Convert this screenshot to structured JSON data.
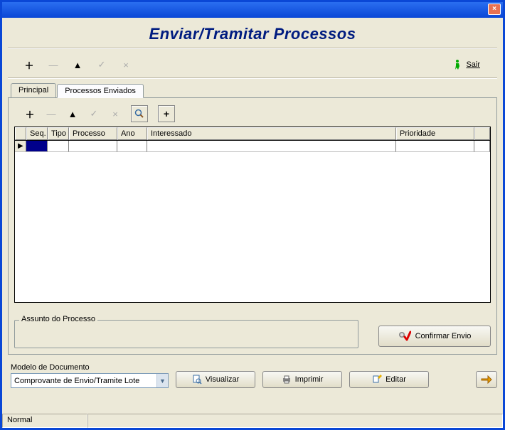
{
  "window": {
    "close_glyph": "×"
  },
  "header": {
    "title": "Enviar/Tramitar Processos"
  },
  "toolbar": {
    "exit_label": "Sair"
  },
  "tabs": {
    "principal": "Principal",
    "enviados": "Processos Enviados"
  },
  "grid": {
    "columns": {
      "seq": "Seq.",
      "tipo": "Tipo",
      "processo": "Processo",
      "ano": "Ano",
      "interessado": "Interessado",
      "prioridade": "Prioridade"
    },
    "row_marker": "▶"
  },
  "assunto": {
    "label": "Assunto do Processo",
    "value": ""
  },
  "buttons": {
    "confirmar": "Confirmar Envio",
    "visualizar": "Visualizar",
    "imprimir": "Imprimir",
    "editar": "Editar"
  },
  "modelo": {
    "label": "Modelo de Documento",
    "selected": "Comprovante de Envio/Tramite Lote"
  },
  "status": {
    "text": "Normal"
  }
}
